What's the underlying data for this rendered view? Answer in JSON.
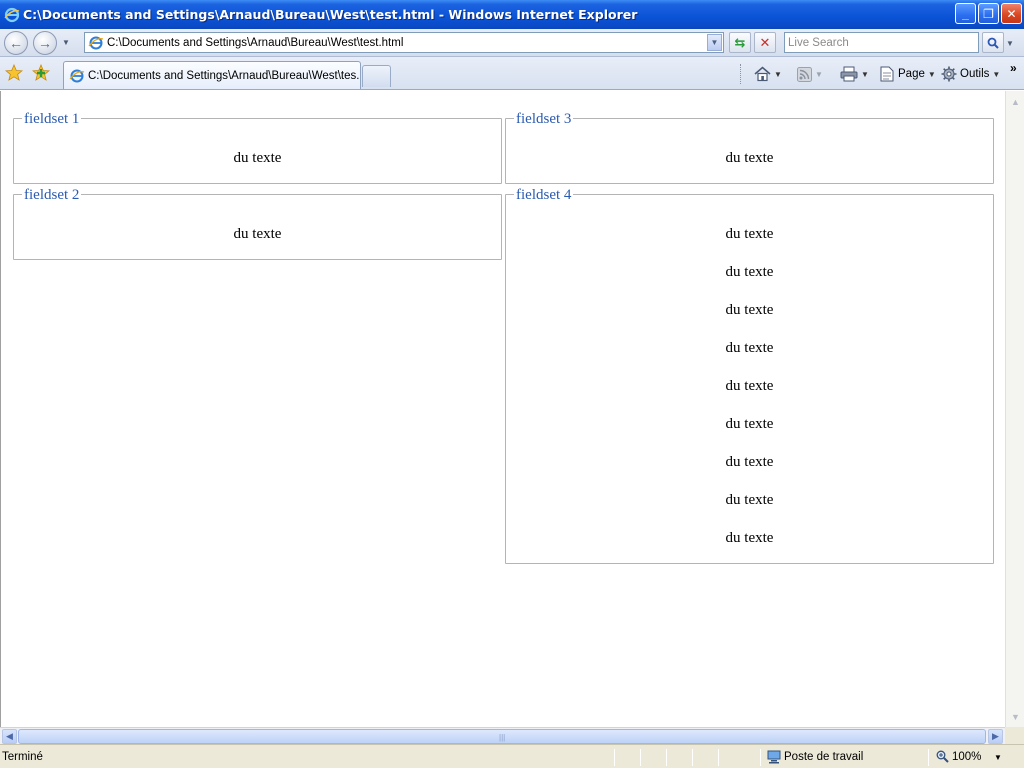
{
  "window": {
    "title": "C:\\Documents and Settings\\Arnaud\\Bureau\\West\\test.html - Windows Internet Explorer",
    "minimize": "_",
    "restore": "❐",
    "close": "✕"
  },
  "navbar": {
    "back": "←",
    "forward": "→",
    "address": "C:\\Documents and Settings\\Arnaud\\Bureau\\West\\test.html",
    "search_placeholder": "Live Search"
  },
  "tabs": [
    {
      "label": "C:\\Documents and Settings\\Arnaud\\Bureau\\West\\tes..."
    }
  ],
  "commands": {
    "page": "Page",
    "tools": "Outils"
  },
  "page": {
    "fieldsets": [
      {
        "legend": "fieldset 1",
        "lines": [
          "du texte"
        ]
      },
      {
        "legend": "fieldset 2",
        "lines": [
          "du texte"
        ]
      },
      {
        "legend": "fieldset 3",
        "lines": [
          "du texte"
        ]
      },
      {
        "legend": "fieldset 4",
        "lines": [
          "du texte",
          "du texte",
          "du texte",
          "du texte",
          "du texte",
          "du texte",
          "du texte",
          "du texte",
          "du texte"
        ]
      }
    ]
  },
  "status": {
    "text": "Terminé",
    "zone": "Poste de travail",
    "zoom": "100%"
  },
  "colors": {
    "titlebar": "#0a53d6",
    "legend": "#2a5bb0",
    "fieldset_border": "#b4b4b4"
  }
}
